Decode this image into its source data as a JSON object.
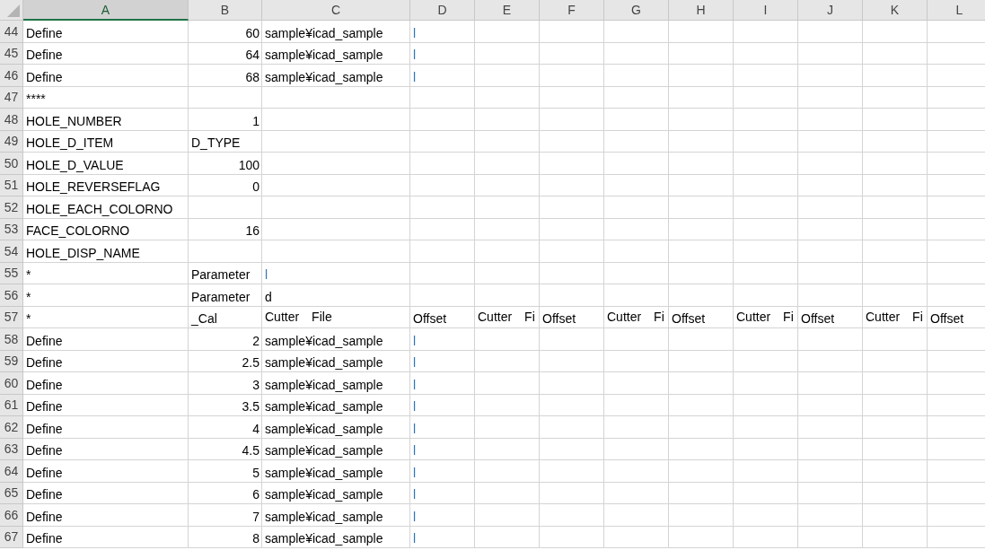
{
  "columns": [
    {
      "label": "A",
      "selected": true
    },
    {
      "label": "B",
      "selected": false
    },
    {
      "label": "C",
      "selected": false
    },
    {
      "label": "D",
      "selected": false
    },
    {
      "label": "E",
      "selected": false
    },
    {
      "label": "F",
      "selected": false
    },
    {
      "label": "G",
      "selected": false
    },
    {
      "label": "H",
      "selected": false
    },
    {
      "label": "I",
      "selected": false
    },
    {
      "label": "J",
      "selected": false
    },
    {
      "label": "K",
      "selected": false
    },
    {
      "label": "L",
      "selected": false
    }
  ],
  "rows": [
    {
      "number": "44",
      "cells": [
        {
          "text": "Define"
        },
        {
          "text": "60",
          "kind": "number"
        },
        {
          "text": "sample¥icad_sample"
        },
        {
          "text": "l",
          "color": "#2e75b6"
        }
      ]
    },
    {
      "number": "45",
      "cells": [
        {
          "text": "Define"
        },
        {
          "text": "64",
          "kind": "number"
        },
        {
          "text": "sample¥icad_sample"
        },
        {
          "text": "l",
          "color": "#2e75b6"
        }
      ]
    },
    {
      "number": "46",
      "cells": [
        {
          "text": "Define"
        },
        {
          "text": "68",
          "kind": "number"
        },
        {
          "text": "sample¥icad_sample"
        },
        {
          "text": "l",
          "color": "#2e75b6"
        }
      ]
    },
    {
      "number": "47",
      "cells": [
        {
          "text": "****"
        }
      ]
    },
    {
      "number": "48",
      "cells": [
        {
          "text": "HOLE_NUMBER"
        },
        {
          "text": "1",
          "kind": "number"
        }
      ]
    },
    {
      "number": "49",
      "cells": [
        {
          "text": "HOLE_D_ITEM"
        },
        {
          "text": "D_TYPE"
        }
      ]
    },
    {
      "number": "50",
      "cells": [
        {
          "text": "HOLE_D_VALUE"
        },
        {
          "text": "100",
          "kind": "number"
        }
      ]
    },
    {
      "number": "51",
      "cells": [
        {
          "text": "HOLE_REVERSEFLAG"
        },
        {
          "text": "0",
          "kind": "number"
        }
      ]
    },
    {
      "number": "52",
      "cells": [
        {
          "text": "HOLE_EACH_COLORNO"
        }
      ]
    },
    {
      "number": "53",
      "cells": [
        {
          "text": "FACE_COLORNO"
        },
        {
          "text": "16",
          "kind": "number"
        }
      ]
    },
    {
      "number": "54",
      "cells": [
        {
          "text": "HOLE_DISP_NAME"
        }
      ]
    },
    {
      "number": "55",
      "cells": [
        {
          "text": "*"
        },
        {
          "text": "Parameter"
        },
        {
          "text": "l",
          "color": "#2e75b6"
        }
      ]
    },
    {
      "number": "56",
      "cells": [
        {
          "text": "*"
        },
        {
          "text": "Parameter"
        },
        {
          "text": "d"
        }
      ]
    },
    {
      "number": "57",
      "cells": [
        {
          "text": "*"
        },
        {
          "text": "_Cal"
        },
        {
          "text": "Cutter　File"
        },
        {
          "text": "Offset"
        },
        {
          "text": "Cutter　Fi"
        },
        {
          "text": "Offset"
        },
        {
          "text": "Cutter　Fi"
        },
        {
          "text": "Offset"
        },
        {
          "text": "Cutter　Fi"
        },
        {
          "text": "Offset"
        },
        {
          "text": "Cutter　Fi"
        },
        {
          "text": "Offset"
        }
      ]
    },
    {
      "number": "58",
      "cells": [
        {
          "text": "Define"
        },
        {
          "text": "2",
          "kind": "number"
        },
        {
          "text": "sample¥icad_sample"
        },
        {
          "text": "l",
          "color": "#2e75b6"
        }
      ]
    },
    {
      "number": "59",
      "cells": [
        {
          "text": "Define"
        },
        {
          "text": "2.5",
          "kind": "number"
        },
        {
          "text": "sample¥icad_sample"
        },
        {
          "text": "l",
          "color": "#2e75b6"
        }
      ]
    },
    {
      "number": "60",
      "cells": [
        {
          "text": "Define"
        },
        {
          "text": "3",
          "kind": "number"
        },
        {
          "text": "sample¥icad_sample"
        },
        {
          "text": "l",
          "color": "#2e75b6"
        }
      ]
    },
    {
      "number": "61",
      "cells": [
        {
          "text": "Define"
        },
        {
          "text": "3.5",
          "kind": "number"
        },
        {
          "text": "sample¥icad_sample"
        },
        {
          "text": "l",
          "color": "#2e75b6"
        }
      ]
    },
    {
      "number": "62",
      "cells": [
        {
          "text": "Define"
        },
        {
          "text": "4",
          "kind": "number"
        },
        {
          "text": "sample¥icad_sample"
        },
        {
          "text": "l",
          "color": "#2e75b6"
        }
      ]
    },
    {
      "number": "63",
      "cells": [
        {
          "text": "Define"
        },
        {
          "text": "4.5",
          "kind": "number"
        },
        {
          "text": "sample¥icad_sample"
        },
        {
          "text": "l",
          "color": "#2e75b6"
        }
      ]
    },
    {
      "number": "64",
      "cells": [
        {
          "text": "Define"
        },
        {
          "text": "5",
          "kind": "number"
        },
        {
          "text": "sample¥icad_sample"
        },
        {
          "text": "l",
          "color": "#2e75b6"
        }
      ]
    },
    {
      "number": "65",
      "cells": [
        {
          "text": "Define"
        },
        {
          "text": "6",
          "kind": "number"
        },
        {
          "text": "sample¥icad_sample"
        },
        {
          "text": "l",
          "color": "#2e75b6"
        }
      ]
    },
    {
      "number": "66",
      "cells": [
        {
          "text": "Define"
        },
        {
          "text": "7",
          "kind": "number"
        },
        {
          "text": "sample¥icad_sample"
        },
        {
          "text": "l",
          "color": "#2e75b6"
        }
      ]
    },
    {
      "number": "67",
      "cells": [
        {
          "text": "Define"
        },
        {
          "text": "8",
          "kind": "number"
        },
        {
          "text": "sample¥icad_sample"
        },
        {
          "text": "l",
          "color": "#2e75b6"
        }
      ]
    }
  ]
}
